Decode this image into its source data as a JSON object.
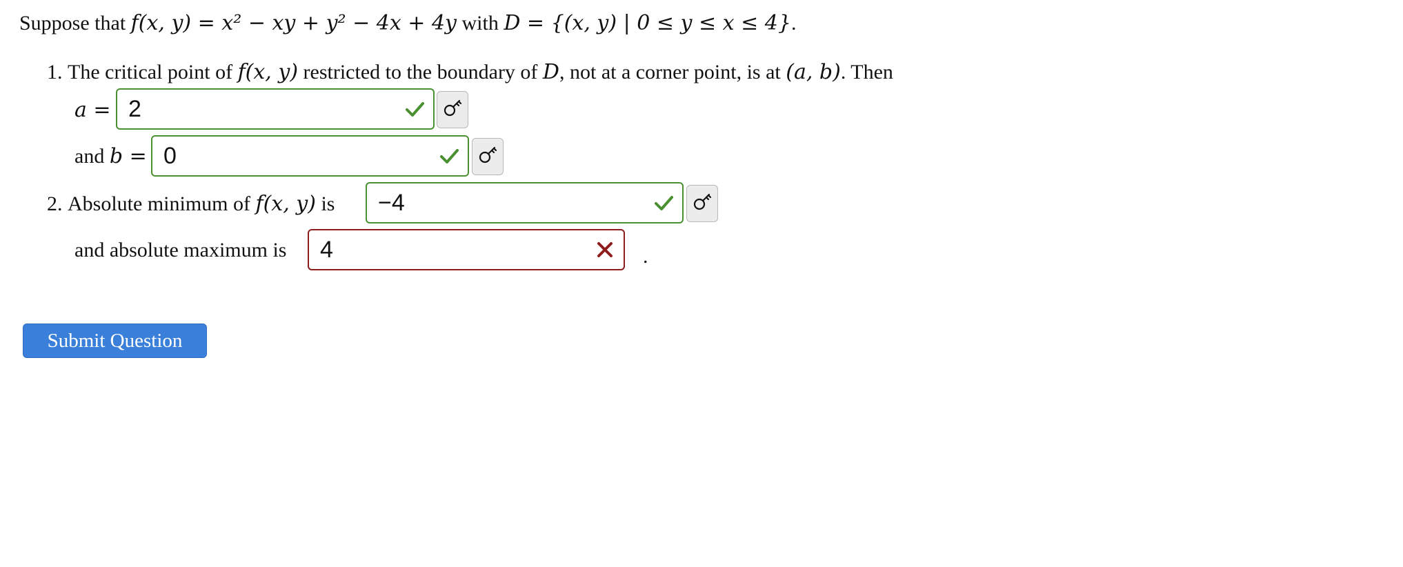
{
  "problem": {
    "intro_text": "Suppose that",
    "function_expr": "f(x, y) = x² − xy + y² − 4x + 4y",
    "with_text": "with",
    "domain_expr": "D = {(x, y) | 0 ≤ y ≤ x ≤ 4}",
    "end_period": "."
  },
  "part1": {
    "number": "1.",
    "text_a": "The critical point of",
    "func": "f(x, y)",
    "text_b": "restricted to the boundary of",
    "dom": "D",
    "text_c": ", not at a corner point, is at",
    "point": "(a, b)",
    "text_d": ". Then",
    "a_label": "a =",
    "a_value": "2",
    "a_status": "correct",
    "b_prefix": "and",
    "b_label": "b =",
    "b_value": "0",
    "b_status": "correct"
  },
  "part2": {
    "number": "2.",
    "min_label": "Absolute minimum of",
    "func": "f(x, y)",
    "is_text": "is",
    "min_value": "−4",
    "min_status": "correct",
    "max_label": "and absolute maximum is",
    "max_value": "4",
    "max_status": "incorrect",
    "trailing": "."
  },
  "colors": {
    "correct": "#4a9030",
    "incorrect": "#8e1c1c",
    "submit_bg": "#3a7fd9"
  },
  "icons": {
    "correct": "checkmark-icon",
    "incorrect": "x-mark-icon",
    "key": "key-icon"
  },
  "submit": {
    "label": "Submit Question"
  }
}
